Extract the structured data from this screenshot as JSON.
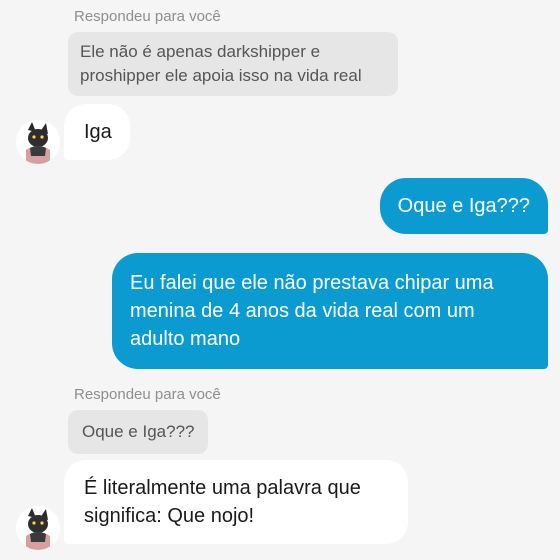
{
  "chat": {
    "messages": [
      {
        "reply_label": "Respondeu para você",
        "quoted_text": "Ele não é apenas darkshipper e proshipper ele apoia isso na vida real"
      },
      {
        "text": "Iga"
      },
      {
        "text": "Oque e Iga???"
      },
      {
        "text": "Eu falei que ele não prestava chipar uma menina de 4 anos da vida real com um adulto mano"
      },
      {
        "reply_label": "Respondeu para você",
        "quoted_text": "Oque e Iga???"
      },
      {
        "text": "É literalmente uma palavra que significa: Que nojo!"
      }
    ]
  },
  "colors": {
    "outgoing_bubble": "#0b9bd1",
    "incoming_bubble": "#ffffff",
    "quoted_bubble": "#e6e6e6",
    "background": "#f5f5f5"
  },
  "icons": {
    "avatar": "cat-avatar-icon"
  }
}
